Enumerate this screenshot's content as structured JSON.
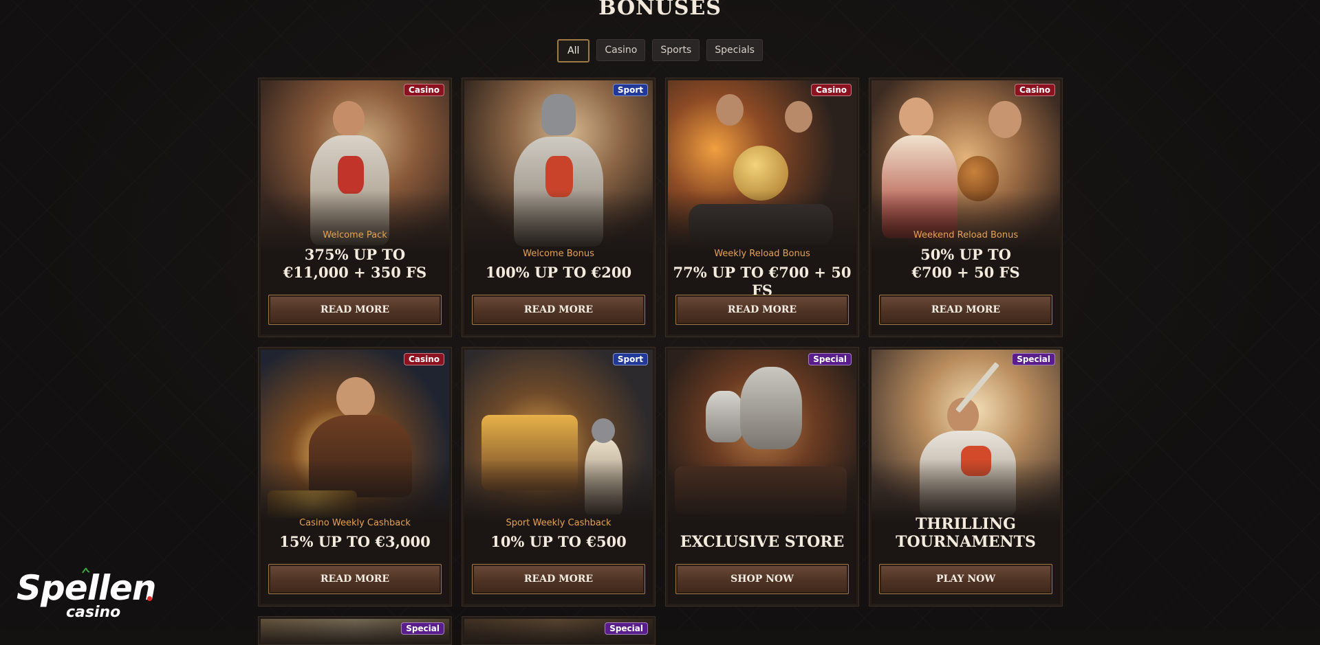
{
  "page": {
    "title": "BONUSES"
  },
  "filters": [
    {
      "label": "All",
      "active": true
    },
    {
      "label": "Casino",
      "active": false
    },
    {
      "label": "Sports",
      "active": false
    },
    {
      "label": "Specials",
      "active": false
    }
  ],
  "cards": [
    {
      "tag": "Casino",
      "subtitle": "Welcome Pack",
      "headline": "375% UP TO\n€11,000 + 350 FS",
      "button": "READ MORE"
    },
    {
      "tag": "Sport",
      "subtitle": "Welcome Bonus",
      "headline": "100% UP TO €200",
      "button": "READ MORE"
    },
    {
      "tag": "Casino",
      "subtitle": "Weekly Reload Bonus",
      "headline": "77% UP TO €700 + 50 FS",
      "button": "READ MORE"
    },
    {
      "tag": "Casino",
      "subtitle": "Weekend Reload Bonus",
      "headline": "50% UP TO\n€700 + 50 FS",
      "button": "READ MORE"
    },
    {
      "tag": "Casino",
      "subtitle": "Casino Weekly Cashback",
      "headline": "15% UP TO €3,000",
      "button": "READ MORE"
    },
    {
      "tag": "Sport",
      "subtitle": "Sport Weekly Cashback",
      "headline": "10% UP TO €500",
      "button": "READ MORE"
    },
    {
      "tag": "Special",
      "subtitle": "",
      "headline": "EXCLUSIVE STORE",
      "button": "SHOP NOW"
    },
    {
      "tag": "Special",
      "subtitle": "",
      "headline": "THRILLING\nTOURNAMENTS",
      "button": "PLAY NOW"
    }
  ],
  "partial_cards": [
    {
      "tag": "Special"
    },
    {
      "tag": "Special"
    }
  ],
  "logo": {
    "word": "Spellen",
    "sub": "casino"
  },
  "colors": {
    "accent": "#e7a24f",
    "casino_tag": "#8c1220",
    "sport_tag": "#213a9a",
    "special_tag": "#5a1d8c"
  }
}
